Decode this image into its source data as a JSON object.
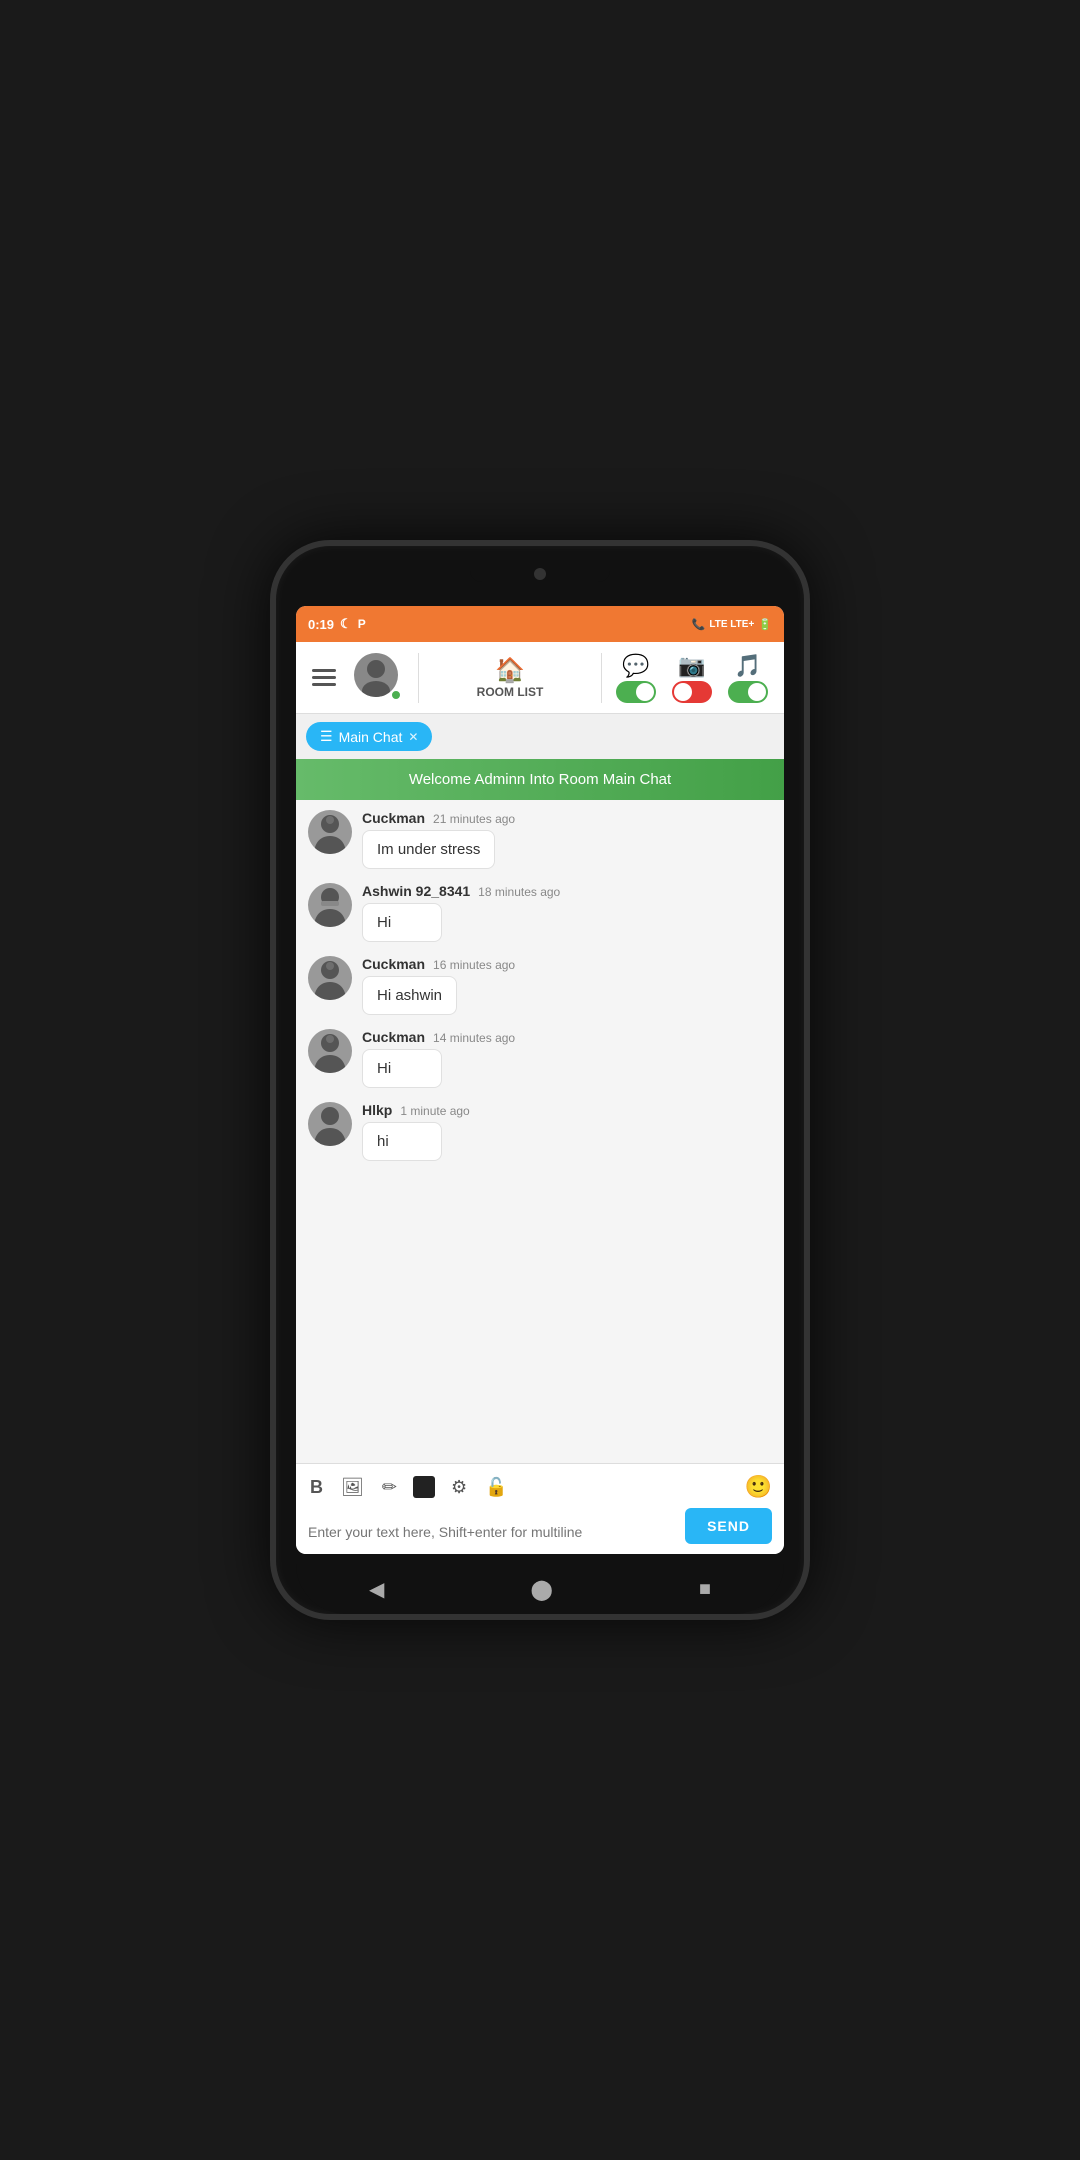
{
  "statusBar": {
    "time": "0:19",
    "icons": [
      "moon",
      "p-icon"
    ],
    "rightIcons": [
      "phone",
      "lte",
      "lte-plus",
      "signal",
      "battery"
    ]
  },
  "topNav": {
    "menuIcon": "≡",
    "roomListLabel": "ROOM LIST",
    "toggleCamera": true,
    "toggleMic": false,
    "toggleMusic": true
  },
  "roomTab": {
    "name": "Main Chat",
    "closeIcon": "✕"
  },
  "welcomeBanner": {
    "text": "Welcome Adminn Into Room Main Chat"
  },
  "messages": [
    {
      "username": "Cuckman",
      "time": "21 minutes ago",
      "text": "Im under stress"
    },
    {
      "username": "Ashwin 92_8341",
      "time": "18 minutes ago",
      "text": "Hi"
    },
    {
      "username": "Cuckman",
      "time": "16 minutes ago",
      "text": "Hi ashwin"
    },
    {
      "username": "Cuckman",
      "time": "14 minutes ago",
      "text": "Hi"
    },
    {
      "username": "Hlkp",
      "time": "1 minute ago",
      "text": "hi"
    }
  ],
  "inputArea": {
    "placeholder": "Enter your text here, Shift+enter for multiline",
    "sendButton": "SEND",
    "toolbar": {
      "bold": "B",
      "image": "🖼",
      "pencil": "✏",
      "colorSwatch": "#222222",
      "settings": "⚙",
      "lock": "🔓",
      "emoji": "🙂"
    }
  },
  "phoneNav": {
    "back": "◀",
    "home": "⬤",
    "square": "■"
  }
}
